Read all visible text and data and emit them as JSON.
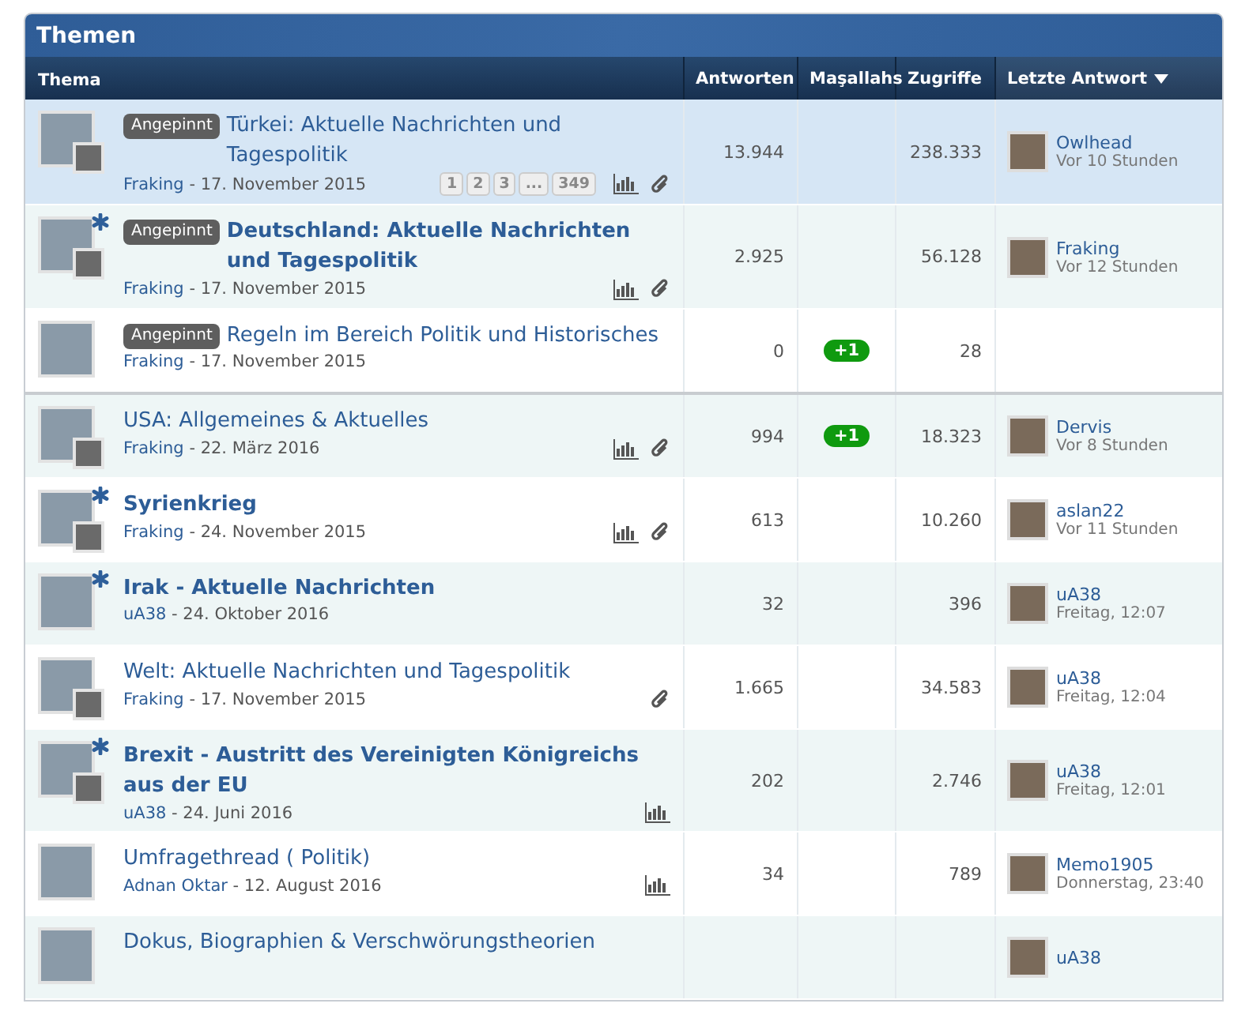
{
  "panel": {
    "title": "Themen"
  },
  "columns": [
    {
      "label": "Thema",
      "sort": false
    },
    {
      "label": "Antworten",
      "sort": false
    },
    {
      "label": "Maşallahs",
      "sort": false
    },
    {
      "label": "Zugriffe",
      "sort": false
    },
    {
      "label": "Letzte Antwort",
      "sort": true
    }
  ],
  "rows": [
    {
      "highlighted": true,
      "sticky_label": "Angepinnt",
      "title": "Türkei: Aktuelle Nachrichten und Tagespolitik",
      "unread": false,
      "reply_avatar": true,
      "starter": "Fraking",
      "date": "- 17. November 2015",
      "pages": [
        "1",
        "2",
        "3",
        "...",
        "349"
      ],
      "poll": true,
      "attachment": true,
      "replies": "13.944",
      "likes": "",
      "views": "238.333",
      "last_user": "Owlhead",
      "last_time": "Vor 10 Stunden",
      "section_end": false
    },
    {
      "highlighted": false,
      "sticky_label": "Angepinnt",
      "title": "Deutschland: Aktuelle Nachrichten und Tagespolitik",
      "unread": true,
      "reply_avatar": true,
      "starter": "Fraking",
      "date": "- 17. November 2015",
      "pages": [],
      "poll": true,
      "attachment": true,
      "replies": "2.925",
      "likes": "",
      "views": "56.128",
      "last_user": "Fraking",
      "last_time": "Vor 12 Stunden",
      "section_end": false
    },
    {
      "highlighted": false,
      "sticky_label": "Angepinnt",
      "title": "Regeln im Bereich Politik und Historisches",
      "unread": false,
      "reply_avatar": false,
      "starter": "Fraking",
      "date": "- 17. November 2015",
      "pages": [],
      "poll": false,
      "attachment": false,
      "replies": "0",
      "likes": "+1",
      "views": "28",
      "last_user": "",
      "last_time": "",
      "section_end": true
    },
    {
      "highlighted": false,
      "sticky_label": "",
      "title": "USA: Allgemeines & Aktuelles",
      "unread": false,
      "reply_avatar": true,
      "starter": "Fraking",
      "date": "- 22. März 2016",
      "pages": [],
      "poll": true,
      "attachment": true,
      "replies": "994",
      "likes": "+1",
      "views": "18.323",
      "last_user": "Dervis",
      "last_time": "Vor 8 Stunden",
      "section_end": false
    },
    {
      "highlighted": false,
      "sticky_label": "",
      "title": "Syrienkrieg",
      "unread": true,
      "reply_avatar": true,
      "starter": "Fraking",
      "date": "- 24. November 2015",
      "pages": [],
      "poll": true,
      "attachment": true,
      "replies": "613",
      "likes": "",
      "views": "10.260",
      "last_user": "aslan22",
      "last_time": "Vor 11 Stunden",
      "section_end": false
    },
    {
      "highlighted": false,
      "sticky_label": "",
      "title": "Irak - Aktuelle Nachrichten",
      "unread": true,
      "reply_avatar": false,
      "starter": "uA38",
      "date": "- 24. Oktober 2016",
      "pages": [],
      "poll": false,
      "attachment": false,
      "replies": "32",
      "likes": "",
      "views": "396",
      "last_user": "uA38",
      "last_time": "Freitag, 12:07",
      "section_end": false
    },
    {
      "highlighted": false,
      "sticky_label": "",
      "title": "Welt: Aktuelle Nachrichten und Tagespolitik",
      "unread": false,
      "reply_avatar": true,
      "starter": "Fraking",
      "date": "- 17. November 2015",
      "pages": [],
      "poll": false,
      "attachment": true,
      "replies": "1.665",
      "likes": "",
      "views": "34.583",
      "last_user": "uA38",
      "last_time": "Freitag, 12:04",
      "section_end": false
    },
    {
      "highlighted": false,
      "sticky_label": "",
      "title": "Brexit - Austritt des Vereinigten Königreichs aus der EU",
      "unread": true,
      "reply_avatar": true,
      "starter": "uA38",
      "date": "- 24. Juni 2016",
      "pages": [],
      "poll": true,
      "attachment": false,
      "replies": "202",
      "likes": "",
      "views": "2.746",
      "last_user": "uA38",
      "last_time": "Freitag, 12:01",
      "section_end": false
    },
    {
      "highlighted": false,
      "sticky_label": "",
      "title": "Umfragethread ( Politik)",
      "unread": false,
      "reply_avatar": false,
      "starter": "Adnan Oktar",
      "date": "- 12. August 2016",
      "pages": [],
      "poll": true,
      "attachment": false,
      "replies": "34",
      "likes": "",
      "views": "789",
      "last_user": "Memo1905",
      "last_time": "Donnerstag, 23:40",
      "section_end": false
    },
    {
      "highlighted": false,
      "sticky_label": "",
      "title": "Dokus, Biographien & Verschwörungstheorien",
      "unread": false,
      "reply_avatar": false,
      "starter": "",
      "date": "",
      "pages": [],
      "poll": false,
      "attachment": false,
      "replies": "",
      "likes": "",
      "views": "",
      "last_user": "uA38",
      "last_time": "",
      "section_end": false
    }
  ]
}
